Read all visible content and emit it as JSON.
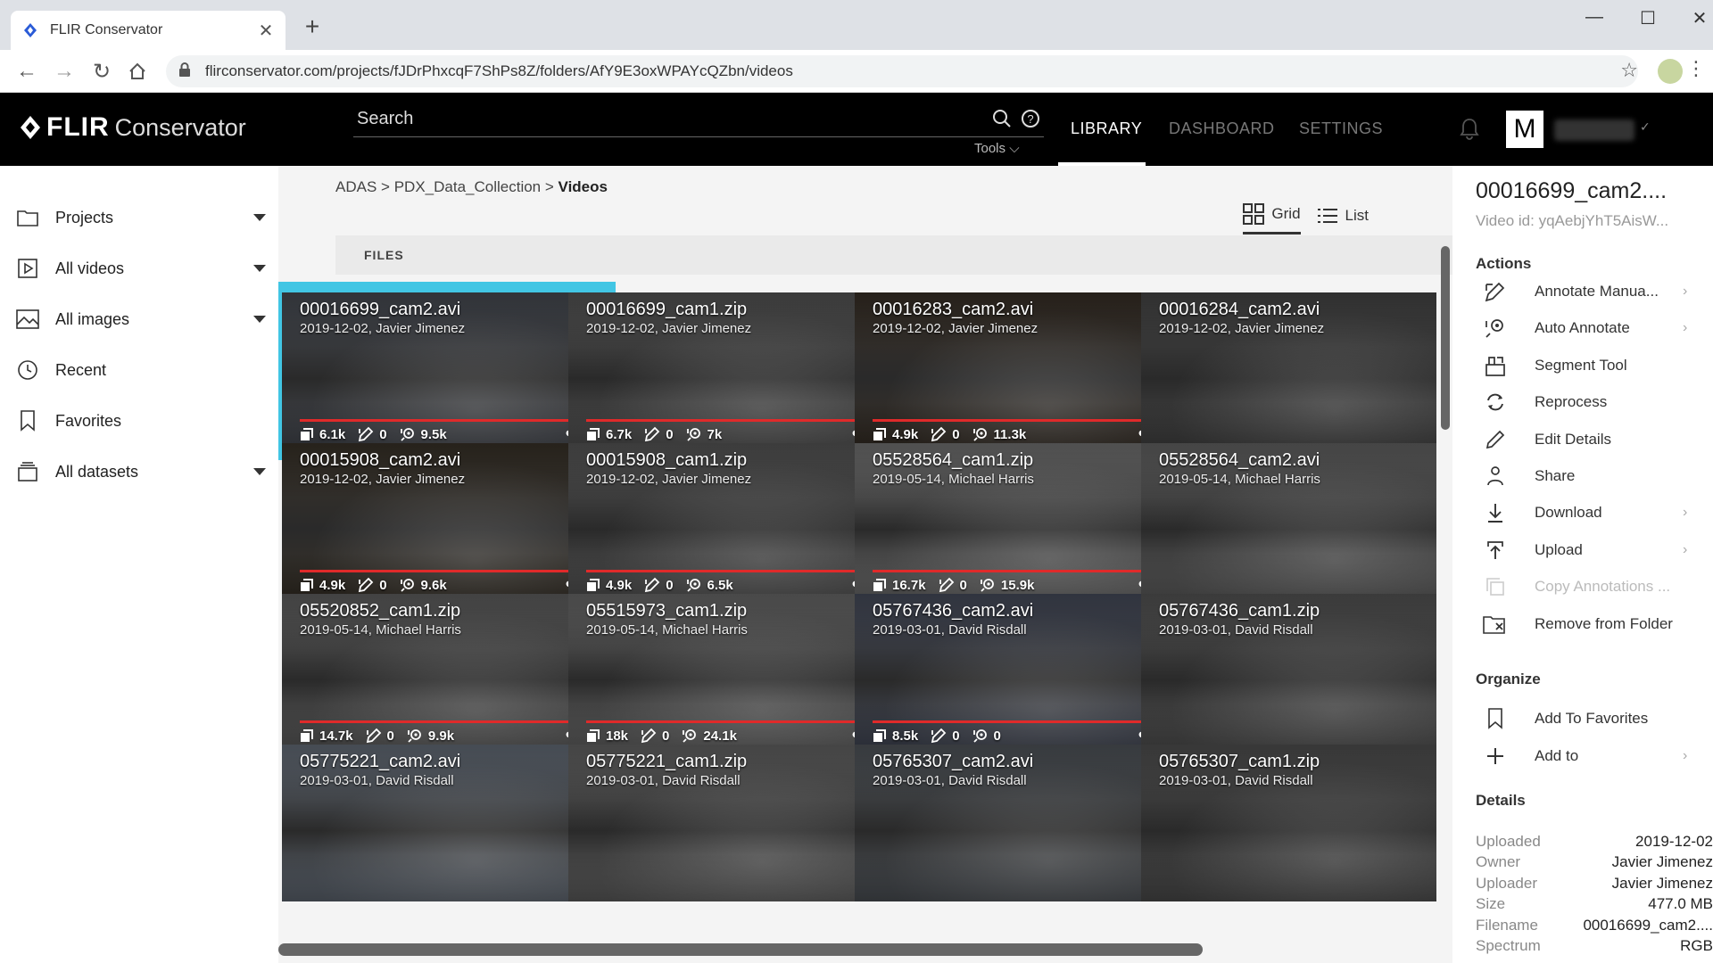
{
  "browser": {
    "tab_title": "FLIR Conservator",
    "url": "flirconservator.com/projects/fJDrPhxcqF7ShPs8Z/folders/AfY9E3oxWPAYcQZbn/videos"
  },
  "header": {
    "logo_flir": "FLIR",
    "logo_conservator": "Conservator",
    "search_label": "Search",
    "tools_label": "Tools",
    "nav": [
      {
        "label": "LIBRARY",
        "active": true
      },
      {
        "label": "DASHBOARD",
        "active": false
      },
      {
        "label": "SETTINGS",
        "active": false
      }
    ],
    "avatar_letter": "M"
  },
  "sidebar": {
    "items": [
      {
        "label": "Projects",
        "icon": "folder-icon",
        "caret": true
      },
      {
        "label": "All videos",
        "icon": "play-icon",
        "caret": true
      },
      {
        "label": "All images",
        "icon": "image-icon",
        "caret": true
      },
      {
        "label": "Recent",
        "icon": "clock-icon",
        "caret": false
      },
      {
        "label": "Favorites",
        "icon": "bookmark-icon",
        "caret": false
      },
      {
        "label": "All datasets",
        "icon": "dataset-icon",
        "caret": true
      }
    ]
  },
  "main": {
    "breadcrumb": [
      "ADAS",
      "PDX_Data_Collection",
      "Videos"
    ],
    "breadcrumb_sep": ">",
    "view_grid": "Grid",
    "view_list": "List",
    "files_label": "FILES",
    "cards": [
      {
        "name": "00016699_cam2.avi",
        "meta": "2019-12-02, Javier Jimenez",
        "frames": "6.1k",
        "annotated": "0",
        "detections": "9.5k",
        "selected": true,
        "bg": "#4b4f57"
      },
      {
        "name": "00016699_cam1.zip",
        "meta": "2019-12-02, Javier Jimenez",
        "frames": "6.7k",
        "annotated": "0",
        "detections": "7k",
        "selected": false,
        "bg": "#5a5a5a"
      },
      {
        "name": "00016283_cam2.avi",
        "meta": "2019-12-02, Javier Jimenez",
        "frames": "4.9k",
        "annotated": "0",
        "detections": "11.3k",
        "selected": false,
        "bg": "#3a3128"
      },
      {
        "name": "00016284_cam2.avi",
        "meta": "2019-12-02, Javier Jimenez",
        "frames": "",
        "annotated": "",
        "detections": "",
        "selected": false,
        "bg": "#4a4a4a"
      },
      {
        "name": "00015908_cam2.avi",
        "meta": "2019-12-02, Javier Jimenez",
        "frames": "4.9k",
        "annotated": "0",
        "detections": "9.6k",
        "selected": false,
        "bg": "#3b342a"
      },
      {
        "name": "00015908_cam1.zip",
        "meta": "2019-12-02, Javier Jimenez",
        "frames": "4.9k",
        "annotated": "0",
        "detections": "6.5k",
        "selected": false,
        "bg": "#5c5c5c"
      },
      {
        "name": "05528564_cam1.zip",
        "meta": "2019-05-14, Michael Harris",
        "frames": "16.7k",
        "annotated": "0",
        "detections": "15.9k",
        "selected": false,
        "bg": "#7a7a7a"
      },
      {
        "name": "05528564_cam2.avi",
        "meta": "2019-05-14, Michael Harris",
        "frames": "",
        "annotated": "",
        "detections": "",
        "selected": false,
        "bg": "#6a6a6a"
      },
      {
        "name": "05520852_cam1.zip",
        "meta": "2019-05-14, Michael Harris",
        "frames": "14.7k",
        "annotated": "0",
        "detections": "9.9k",
        "selected": false,
        "bg": "#666666"
      },
      {
        "name": "05515973_cam1.zip",
        "meta": "2019-05-14, Michael Harris",
        "frames": "18k",
        "annotated": "0",
        "detections": "24.1k",
        "selected": false,
        "bg": "#707070"
      },
      {
        "name": "05767436_cam2.avi",
        "meta": "2019-03-01, David Risdall",
        "frames": "8.5k",
        "annotated": "0",
        "detections": "0",
        "selected": false,
        "bg": "#4a5060"
      },
      {
        "name": "05767436_cam1.zip",
        "meta": "2019-03-01, David Risdall",
        "frames": "",
        "annotated": "",
        "detections": "",
        "selected": false,
        "bg": "#5a5a5a"
      },
      {
        "name": "05775221_cam2.avi",
        "meta": "2019-03-01, David Risdall",
        "frames": "",
        "annotated": "",
        "detections": "",
        "selected": false,
        "bg": "#6b7480"
      },
      {
        "name": "05775221_cam1.zip",
        "meta": "2019-03-01, David Risdall",
        "frames": "",
        "annotated": "",
        "detections": "",
        "selected": false,
        "bg": "#6a6a6a"
      },
      {
        "name": "05765307_cam2.avi",
        "meta": "2019-03-01, David Risdall",
        "frames": "",
        "annotated": "",
        "detections": "",
        "selected": false,
        "bg": "#555a60"
      },
      {
        "name": "05765307_cam1.zip",
        "meta": "2019-03-01, David Risdall",
        "frames": "",
        "annotated": "",
        "detections": "",
        "selected": false,
        "bg": "#555555"
      }
    ]
  },
  "panel": {
    "title": "00016699_cam2....",
    "video_id": "Video id: yqAebjYhT5AisW...",
    "actions_label": "Actions",
    "actions": [
      {
        "label": "Annotate Manua...",
        "icon": "annotate-icon",
        "chevron": true,
        "disabled": false
      },
      {
        "label": "Auto Annotate",
        "icon": "auto-annotate-icon",
        "chevron": true,
        "disabled": false
      },
      {
        "label": "Segment Tool",
        "icon": "segment-icon",
        "chevron": false,
        "disabled": false
      },
      {
        "label": "Reprocess",
        "icon": "reprocess-icon",
        "chevron": false,
        "disabled": false
      },
      {
        "label": "Edit Details",
        "icon": "pencil-icon",
        "chevron": false,
        "disabled": false
      },
      {
        "label": "Share",
        "icon": "share-icon",
        "chevron": false,
        "disabled": false
      },
      {
        "label": "Download",
        "icon": "download-icon",
        "chevron": true,
        "disabled": false
      },
      {
        "label": "Upload",
        "icon": "upload-icon",
        "chevron": true,
        "disabled": false
      },
      {
        "label": "Copy Annotations ...",
        "icon": "copy-icon",
        "chevron": false,
        "disabled": true
      },
      {
        "label": "Remove from Folder",
        "icon": "remove-folder-icon",
        "chevron": false,
        "disabled": false
      }
    ],
    "organize_label": "Organize",
    "organize": [
      {
        "label": "Add To Favorites",
        "icon": "bookmark-icon",
        "chevron": false
      },
      {
        "label": "Add to",
        "icon": "plus-icon",
        "chevron": true
      }
    ],
    "details_label": "Details",
    "details": [
      {
        "key": "Uploaded",
        "value": "2019-12-02"
      },
      {
        "key": "Owner",
        "value": "Javier Jimenez"
      },
      {
        "key": "Uploader",
        "value": "Javier Jimenez"
      },
      {
        "key": "Size",
        "value": "477.0 MB"
      },
      {
        "key": "Filename",
        "value": "00016699_cam2...."
      },
      {
        "key": "Spectrum",
        "value": "RGB"
      }
    ]
  }
}
